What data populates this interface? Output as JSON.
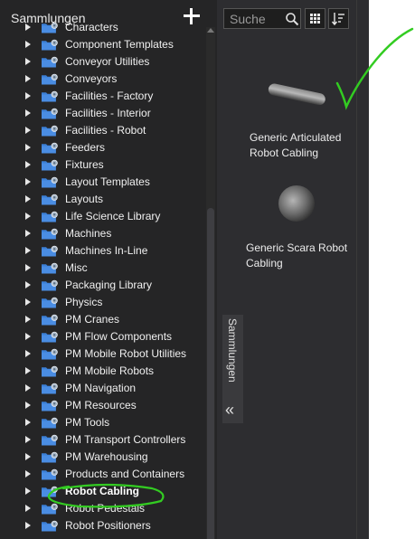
{
  "panel": {
    "title": "Sammlungen",
    "add_label": "+"
  },
  "tree_items": [
    {
      "label": "Characters"
    },
    {
      "label": "Component Templates"
    },
    {
      "label": "Conveyor Utilities"
    },
    {
      "label": "Conveyors"
    },
    {
      "label": "Facilities - Factory"
    },
    {
      "label": "Facilities - Interior"
    },
    {
      "label": "Facilities - Robot"
    },
    {
      "label": "Feeders"
    },
    {
      "label": "Fixtures"
    },
    {
      "label": "Layout Templates"
    },
    {
      "label": "Layouts"
    },
    {
      "label": "Life Science Library"
    },
    {
      "label": "Machines"
    },
    {
      "label": "Machines In-Line"
    },
    {
      "label": "Misc"
    },
    {
      "label": "Packaging Library"
    },
    {
      "label": "Physics"
    },
    {
      "label": "PM Cranes"
    },
    {
      "label": "PM Flow Components"
    },
    {
      "label": "PM Mobile Robot Utilities"
    },
    {
      "label": "PM Mobile Robots"
    },
    {
      "label": "PM Navigation"
    },
    {
      "label": "PM Resources"
    },
    {
      "label": "PM Tools"
    },
    {
      "label": "PM Transport Controllers"
    },
    {
      "label": "PM Warehousing"
    },
    {
      "label": "Products and Containers"
    },
    {
      "label": "Robot Cabling",
      "selected": true
    },
    {
      "label": "Robot Pedestals"
    },
    {
      "label": "Robot Positioners"
    }
  ],
  "search": {
    "placeholder": "Suche"
  },
  "items": [
    {
      "line1": "Generic Articulated",
      "line2": "Robot Cabling",
      "icon": "cable-cylinder-icon"
    },
    {
      "line1": "Generic Scara Robot",
      "line2": "Cabling",
      "icon": "cable-sphere-icon"
    }
  ],
  "side_tab": {
    "label": "Sammlungen",
    "chevron": "«"
  },
  "colors": {
    "panel_bg": "#252526",
    "app_bg": "#2d2d30",
    "folder_blue": "#3b7fd6",
    "annotation_green": "#33cc22"
  }
}
